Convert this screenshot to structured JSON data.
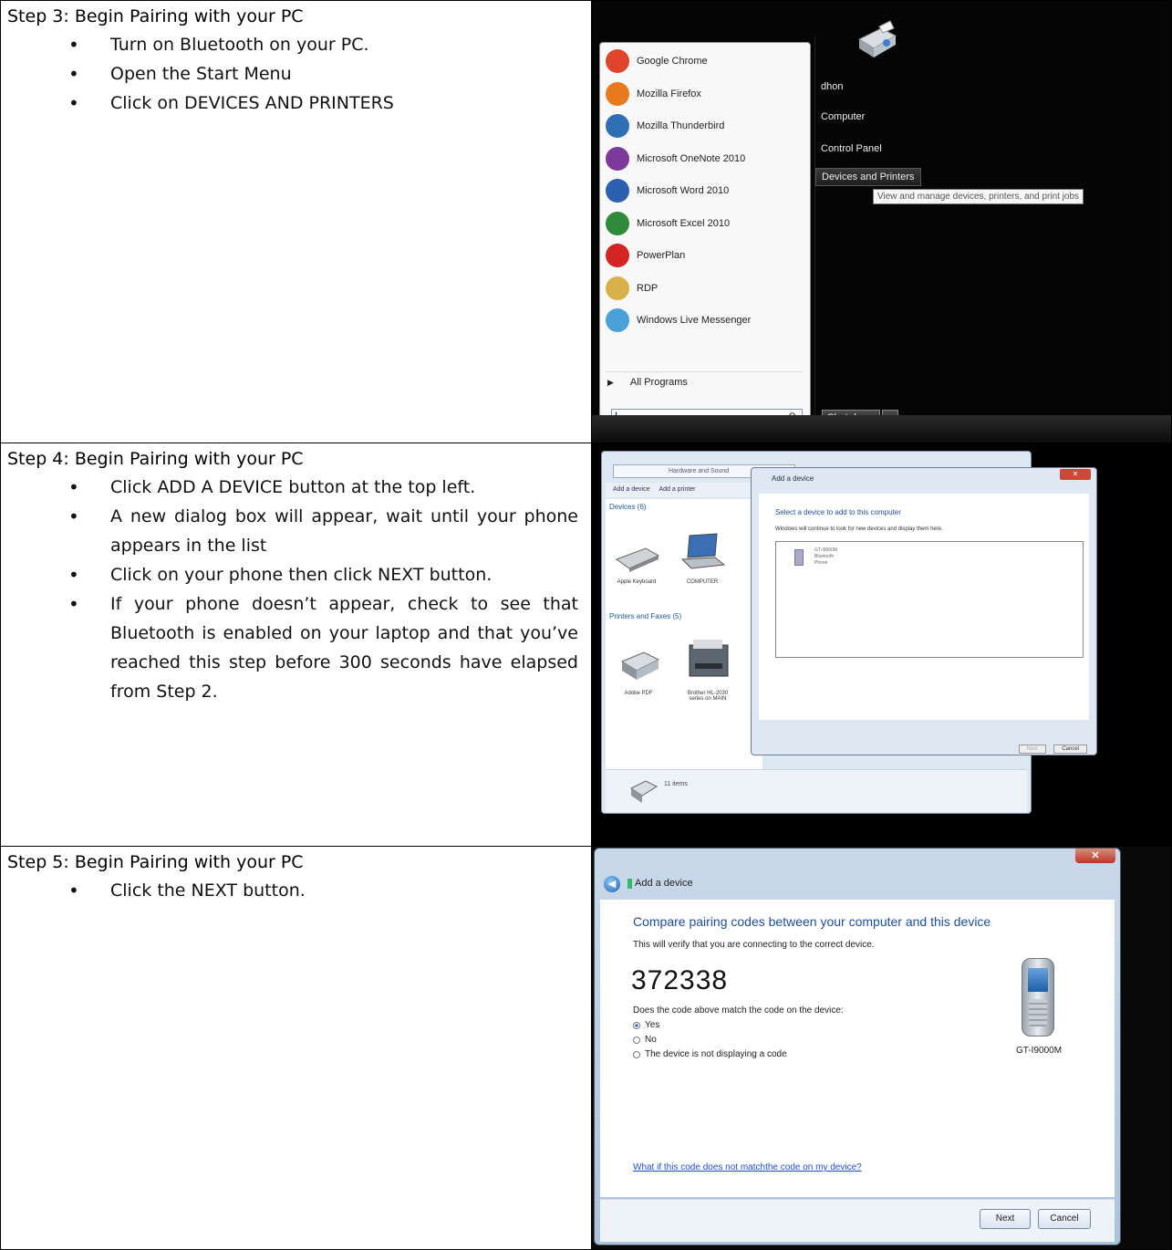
{
  "steps": [
    {
      "title": "Step 3: Begin Pairing with your PC",
      "bullets": [
        "Turn on Bluetooth on your PC.",
        "Open the Start Menu",
        "Click on DEVICES AND PRINTERS"
      ]
    },
    {
      "title": "Step 4: Begin Pairing with your PC",
      "bullets": [
        "Click ADD A DEVICE button at the top left.",
        "A new dialog box will appear, wait until your phone appears in the list",
        "Click on your phone then click NEXT button.",
        "If your phone doesn’t appear, check to see that Bluetooth is enabled on your laptop and that you’ve reached this step before 300 seconds have elapsed from Step 2."
      ]
    },
    {
      "title": "Step 5: Begin Pairing with your PC",
      "bullets": [
        "Click the NEXT button."
      ]
    }
  ],
  "start_menu": {
    "programs": [
      {
        "label": "Google Chrome",
        "color": "#e0452c"
      },
      {
        "label": "Mozilla Firefox",
        "color": "#e8791d"
      },
      {
        "label": "Mozilla Thunderbird",
        "color": "#2f6fb3"
      },
      {
        "label": "Microsoft OneNote 2010",
        "color": "#7e3a9a"
      },
      {
        "label": "Microsoft Word 2010",
        "color": "#2b5fb0"
      },
      {
        "label": "Microsoft Excel 2010",
        "color": "#2f8a3a"
      },
      {
        "label": "PowerPlan",
        "color": "#d42424"
      },
      {
        "label": "RDP",
        "color": "#d9b14a"
      },
      {
        "label": "Windows Live Messenger",
        "color": "#4aa0d8"
      }
    ],
    "all_programs": "All Programs",
    "right_links": [
      "dhon",
      "Computer",
      "Control Panel",
      "Devices and Printers"
    ],
    "tooltip": "View and manage devices, printers, and print jobs",
    "shutdown": "Shut down"
  },
  "devices_printers": {
    "address": "Hardware and Sound",
    "toolbar": [
      "Add a device",
      "Add a printer"
    ],
    "devices_header": "Devices (6)",
    "devices": [
      "Apple Keyboard",
      "COMPUTER"
    ],
    "printers_header": "Printers and Faxes (5)",
    "printers": [
      "Adobe PDF",
      "Brother HL-2030 series on MAIN"
    ],
    "status": "11 items",
    "dialog": {
      "title": "Add a device",
      "heading": "Select a device to add to this computer",
      "sub": "Windows will continue to look for new devices and display them here.",
      "device_name": "GT-I9000M",
      "device_lines": [
        "Bluetooth",
        "Phone"
      ],
      "next": "Next",
      "cancel": "Cancel"
    }
  },
  "pairing": {
    "window_title": "Add a device",
    "heading": "Compare pairing codes between your computer and this device",
    "sub": "This will verify that you are connecting to the correct device.",
    "code": "372338",
    "question": "Does the code above match the code on the device:",
    "options": [
      "Yes",
      "No",
      "The device is not displaying a code"
    ],
    "selected": "Yes",
    "device_name": "GT-I9000M",
    "help_link": "What if this code does not matchthe code on my device?",
    "next": "Next",
    "cancel": "Cancel"
  }
}
